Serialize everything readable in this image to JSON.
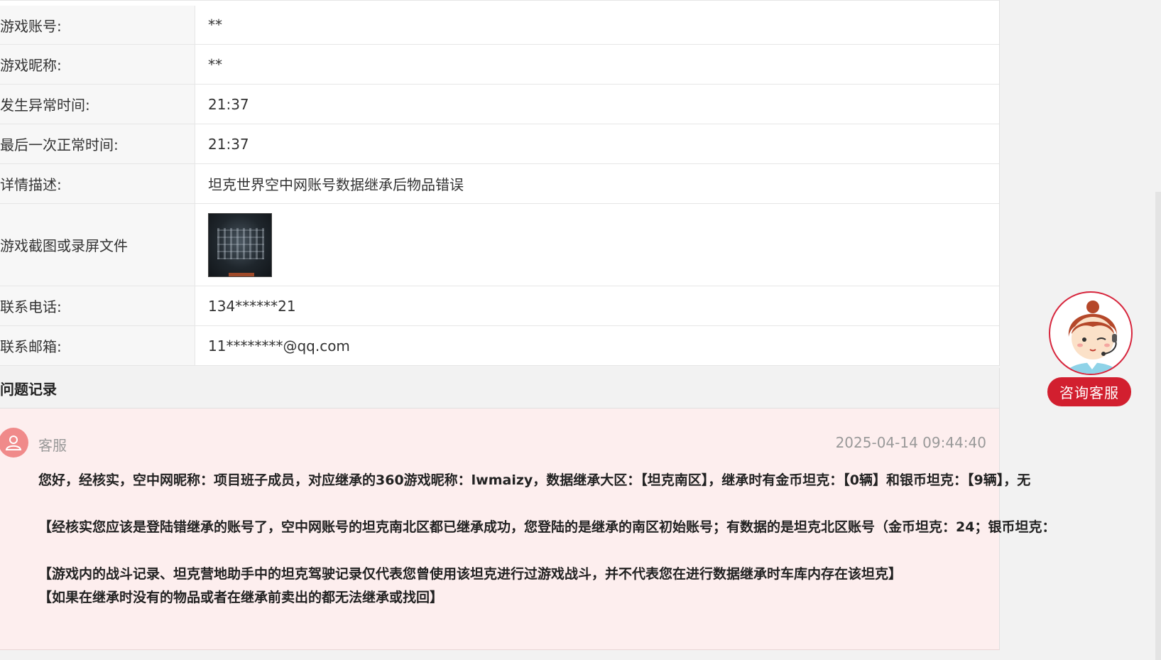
{
  "info_rows": [
    {
      "label": "游戏账号:",
      "value": "**"
    },
    {
      "label": "游戏昵称:",
      "value": "**"
    },
    {
      "label": "发生异常时间:",
      "value": "21:37"
    },
    {
      "label": "最后一次正常时间:",
      "value": "21:37"
    },
    {
      "label": "详情描述:",
      "value": "坦克世界空中网账号数据继承后物品错误"
    },
    {
      "label": "游戏截图或录屏文件",
      "value": ""
    },
    {
      "label": "联系电话:",
      "value": "134******21"
    },
    {
      "label": "联系邮箱:",
      "value": "11********@qq.com"
    }
  ],
  "section": {
    "title": "问题记录"
  },
  "record": {
    "sender": "客服",
    "timestamp": "2025-04-14 09:44:40",
    "lines": [
      "您好，经核实，空中网昵称：项目班子成员，对应继承的360游戏昵称：lwmaizy，数据继承大区：【坦克南区】，继承时有金币坦克：【0辆】和银币坦克：【9辆】，无",
      "【经核实您应该是登陆错继承的账号了，空中网账号的坦克南北区都已继承成功，您登陆的是继承的南区初始账号；有数据的是坦克北区账号（金币坦克：24；银币坦克：",
      "【游戏内的战斗记录、坦克营地助手中的坦克驾驶记录仅代表您曾使用该坦克进行过游戏战斗，并不代表您在进行数据继承时车库内存在该坦克】",
      "【如果在继承时没有的物品或者在继承前卖出的都无法继承或找回】"
    ]
  },
  "support_widget": {
    "label": "咨询客服"
  }
}
